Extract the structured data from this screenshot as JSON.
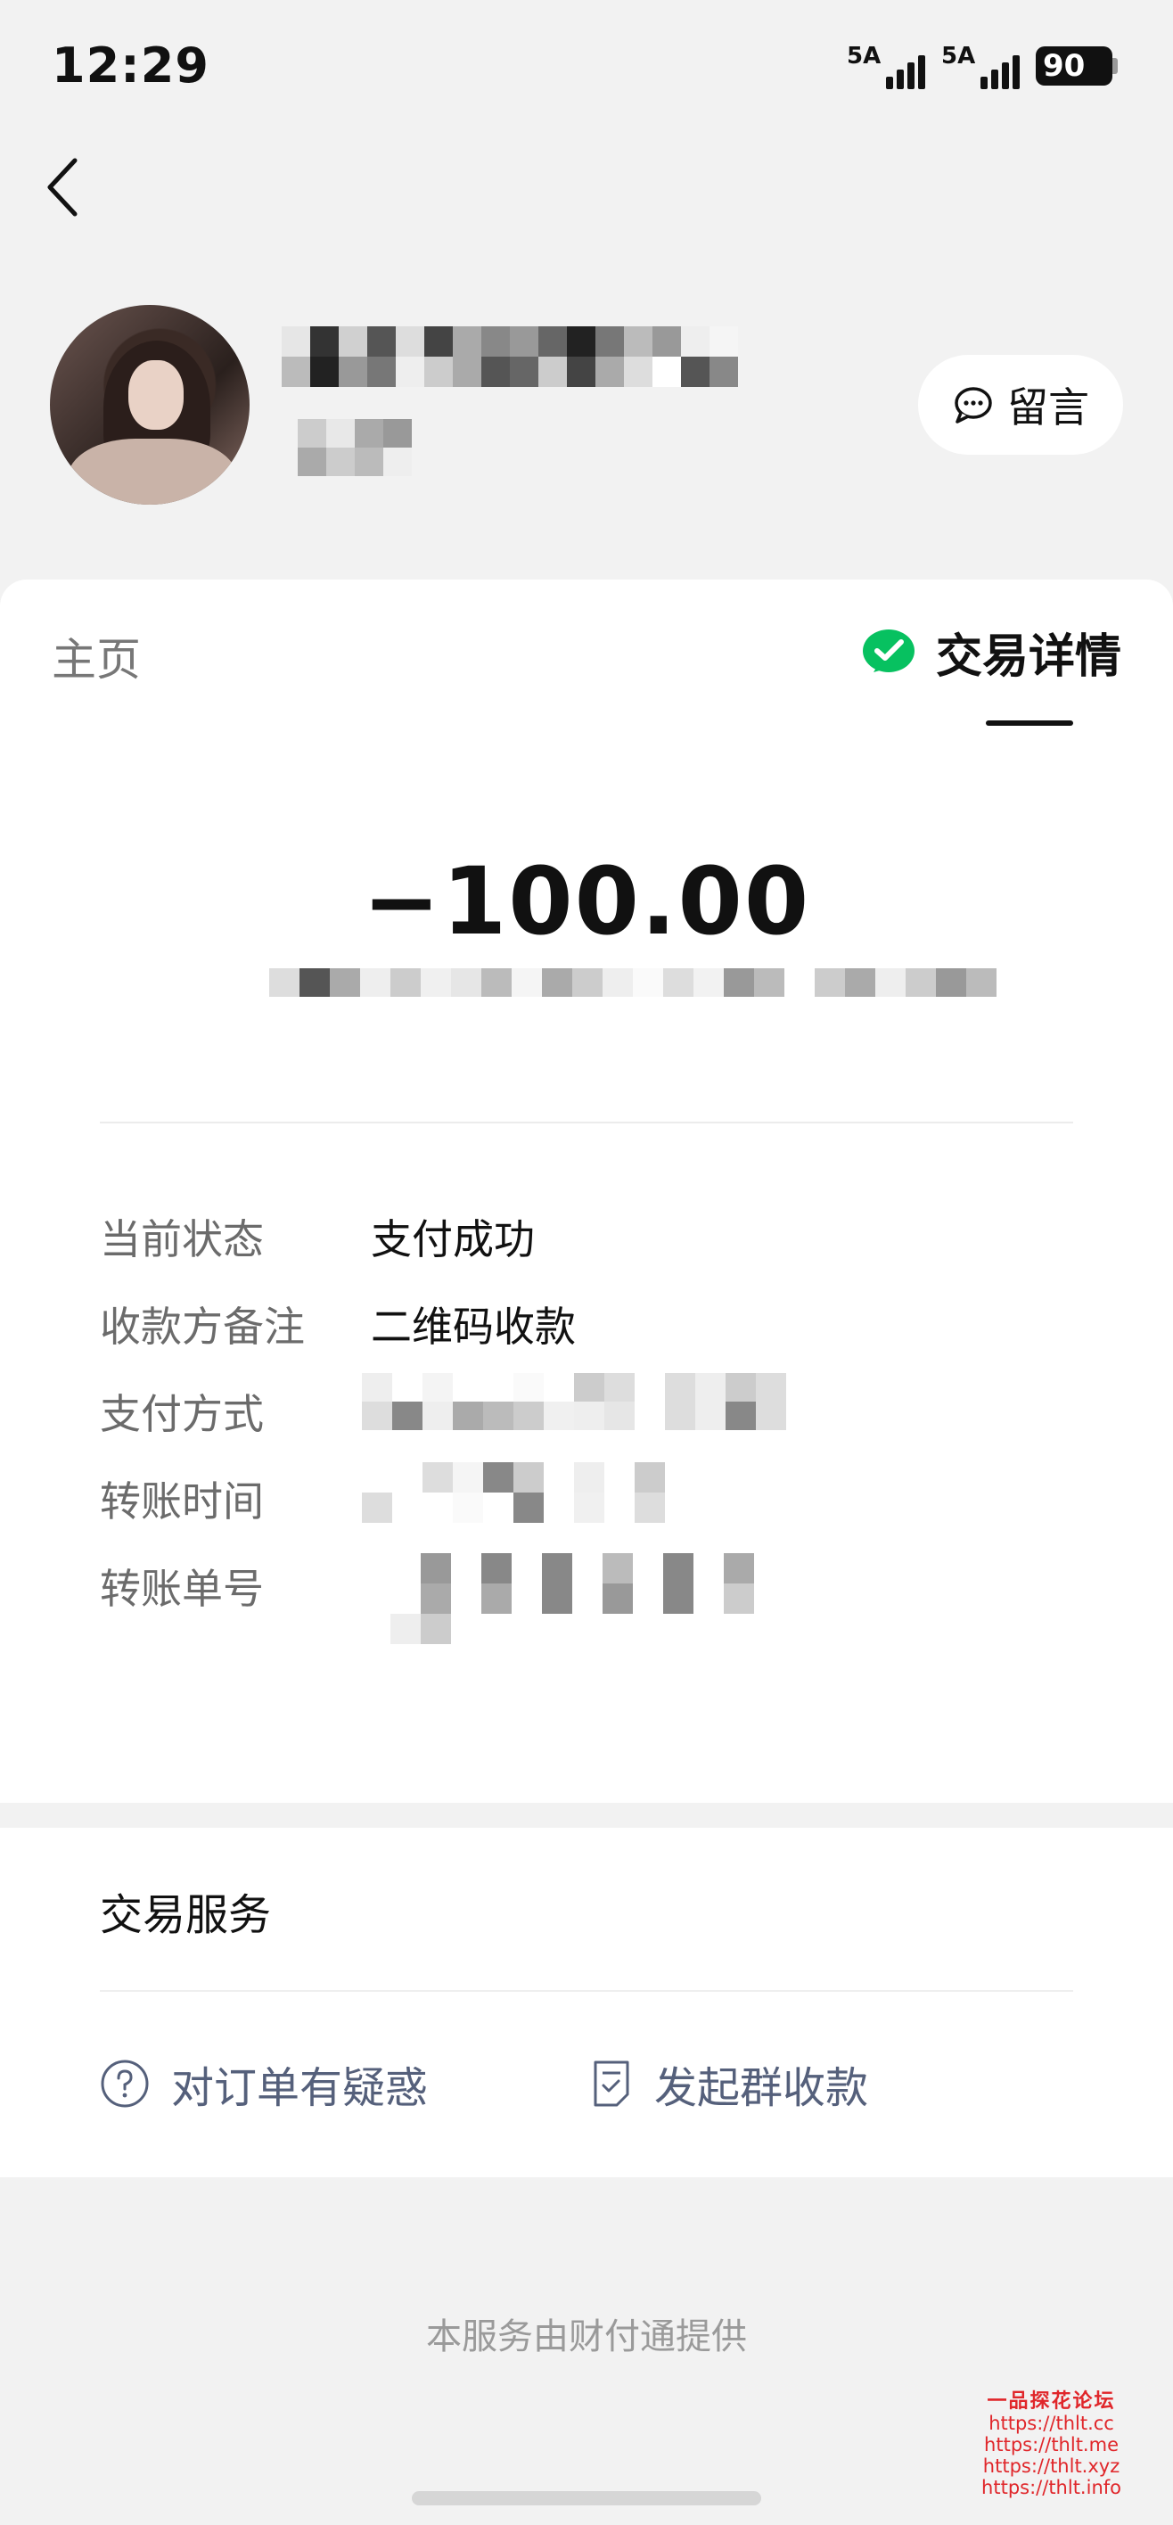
{
  "status_bar": {
    "time": "12:29",
    "network1": "5A",
    "network2": "5A",
    "battery": "90"
  },
  "profile": {
    "message_button": "留言"
  },
  "tabs": {
    "home": "主页",
    "detail": "交易详情"
  },
  "transaction": {
    "amount": "−100.00",
    "rows": [
      {
        "label": "当前状态",
        "value": "支付成功"
      },
      {
        "label": "收款方备注",
        "value": "二维码收款"
      },
      {
        "label": "支付方式",
        "value": ""
      },
      {
        "label": "转账时间",
        "value": ""
      },
      {
        "label": "转账单号",
        "value": ""
      }
    ]
  },
  "services": {
    "title": "交易服务",
    "link_question": "对订单有疑惑",
    "link_group": "发起群收款"
  },
  "footer": "本服务由财付通提供",
  "watermark": {
    "title": "一品探花论坛",
    "urls": [
      "https://thlt.cc",
      "https://thlt.me",
      "https://thlt.xyz",
      "https://thlt.info"
    ]
  },
  "colors": {
    "wechat_green": "#07c160",
    "link": "#55607b",
    "watermark": "#e0262a"
  }
}
